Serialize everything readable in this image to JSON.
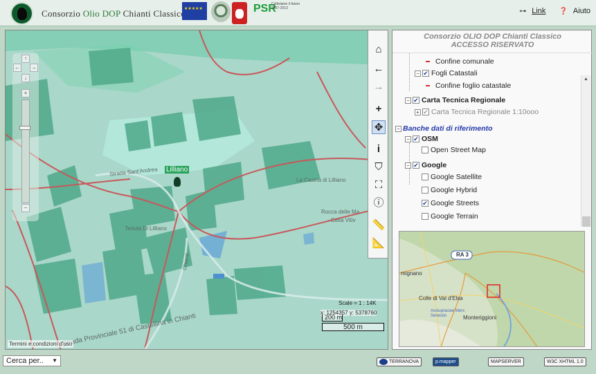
{
  "header": {
    "title_prefix": "Consorzio",
    "title_accent": "Olio DOP",
    "title_suffix": "Chianti Classico",
    "psr_label": "PSR",
    "psr_sub": "Coltiviamo il futuro",
    "psr_years": "2007-2013",
    "link_label": "Link",
    "help_label": "Aiuto"
  },
  "map": {
    "labels": {
      "lilliano": "Lilliano",
      "casina": "La Casina di Lilliano",
      "tenuta": "Tenuta Di Lilliano",
      "rocca": "Rocca delle Ma",
      "casa": "- Casa Vitiv",
      "road1": "Strada Sant'Andrea",
      "road2": "Strada Provinciale 51 di Castellina in Chianti",
      "chianti": "Chianti"
    },
    "scale_text": "Scale = 1 : 14K",
    "coords": "x: 1254357  y: 5378760",
    "scalebar_small": "200 m",
    "scalebar_large": "500 m",
    "terms": "Termini e condizioni d'uso"
  },
  "toolbar": {
    "tools": [
      "home-icon",
      "back-icon",
      "forward-icon",
      "zoom-in-icon",
      "pan-icon",
      "identify-icon",
      "select-icon",
      "search-area-icon",
      "info-icon",
      "measure-icon",
      "measure-area-icon"
    ],
    "selected": "pan-icon"
  },
  "right_panel": {
    "title_line1": "Consorzio OLIO DOP Chianti Classico",
    "title_line2": "ACCESSO RISERVATO",
    "tree": {
      "confine_comunale": "Confine comunale",
      "fogli_catastali": "Fogli Catastali",
      "confine_foglio": "Confine foglio catastale",
      "carta_tecnica": "Carta Tecnica Regionale",
      "carta_tecnica_sub": "Carta Tecnica Regionale 1:10ooo",
      "banche_dati": "Banche dati di riferimento",
      "osm": "OSM",
      "open_street_map": "Open Street Map",
      "google": "Google",
      "google_satellite": "Google Satellite",
      "google_hybrid": "Google Hybrid",
      "google_streets": "Google Streets",
      "google_terrain": "Google Terrain"
    },
    "overview": {
      "ra3": "RA 3",
      "mignano": "mignano",
      "colle": "Colle di Val d'Elsa",
      "avs": "Avsiupraciee Merx Senesiio",
      "monteriggioni": "Monteriggioni"
    }
  },
  "footer": {
    "search_label": "Cerca per..",
    "badges": [
      "TERRANOVA",
      "p.mapper",
      "MAPSERVER",
      "W3C XHTML 1.0"
    ]
  },
  "colors": {
    "header_bg": "#e6efe9",
    "body_bg": "#bfd7c6",
    "map_base": "#a9d7c9",
    "parcel": "#4fa98a",
    "road": "#c9575a",
    "accent_title": "#2b7a3a",
    "tree_heading": "#2438a8"
  }
}
